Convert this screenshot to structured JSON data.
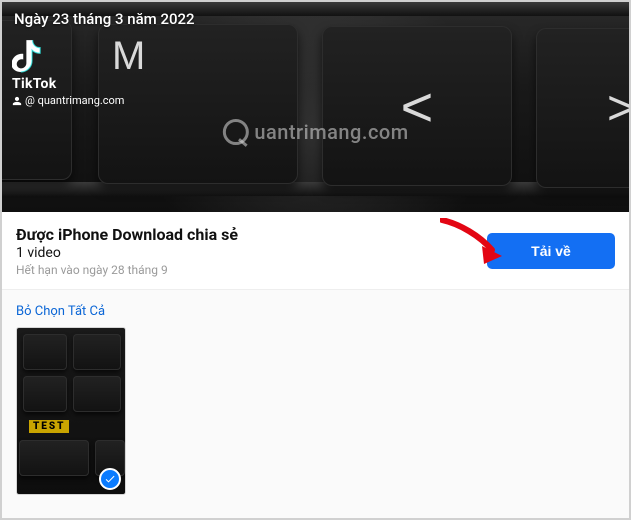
{
  "hero": {
    "date_label": "Ngày 23 tháng 3 năm 2022",
    "tiktok_brand": "TikTok",
    "tiktok_handle": "quantrimang.com",
    "watermark_text": "uantrimang.com",
    "keys": {
      "m": "M",
      "less": "<",
      "greater": ">"
    }
  },
  "info": {
    "title": "Được iPhone Download chia sẻ",
    "count_label": "1 video",
    "expiry_label": "Hết hạn vào ngày 28 tháng 9",
    "download_label": "Tải về"
  },
  "actions": {
    "deselect_all": "Bỏ Chọn Tất Cả"
  },
  "thumb": {
    "tag": "TEST"
  }
}
